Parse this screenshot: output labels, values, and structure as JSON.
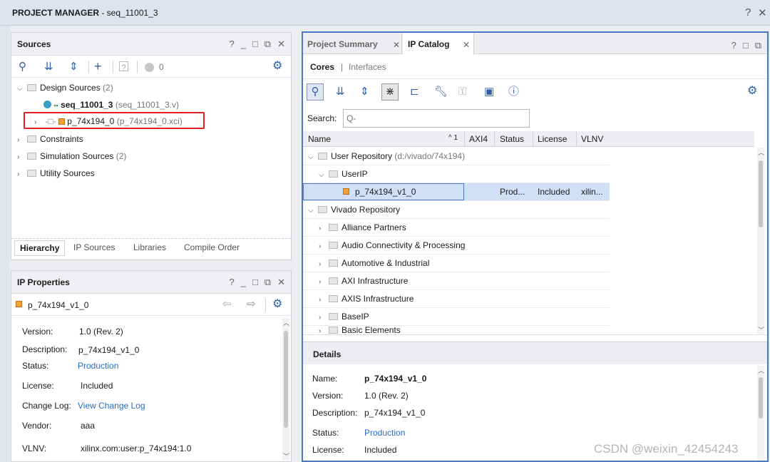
{
  "window": {
    "title": "PROJECT MANAGER",
    "project": " - seq_11001_3",
    "help": "?",
    "close": "✕"
  },
  "sources": {
    "title": "Sources",
    "badge": "0",
    "tree": {
      "design_sources": "Design Sources",
      "design_count": "(2)",
      "top_module": "seq_11001_3",
      "top_file": "(seq_11001_3.v)",
      "ip_module": "p_74x194_0",
      "ip_file": "(p_74x194_0.xci)",
      "constraints": "Constraints",
      "sim_sources": "Simulation Sources",
      "sim_count": "(2)",
      "utility": "Utility Sources"
    },
    "tabs": [
      "Hierarchy",
      "IP Sources",
      "Libraries",
      "Compile Order"
    ]
  },
  "ip_properties": {
    "title": "IP Properties",
    "ip_name": "p_74x194_v1_0",
    "fields": {
      "version_label": "Version:",
      "version": "1.0 (Rev. 2)",
      "description_label": "Description:",
      "description": "p_74x194_v1_0",
      "status_label": "Status:",
      "status": "Production",
      "license_label": "License:",
      "license": "Included",
      "changelog_label": "Change Log:",
      "changelog": "View Change Log",
      "vendor_label": "Vendor:",
      "vendor": "aaa",
      "vlnv_label": "VLNV:",
      "vlnv": "xilinx.com:user:p_74x194:1.0"
    }
  },
  "ipcatalog": {
    "tabs": [
      "Project Summary",
      "IP Catalog"
    ],
    "subtabs": {
      "cores": "Cores",
      "sep": "|",
      "interfaces": "Interfaces"
    },
    "search_label": "Search:",
    "search_placeholder": "Q-",
    "columns": {
      "name": "Name",
      "sort": "^ 1",
      "axi4": "AXI4",
      "status": "Status",
      "license": "License",
      "vlnv": "VLNV"
    },
    "rows": {
      "user_repo": "User Repository",
      "user_repo_path": "(d:/vivado/74x194)",
      "userip": "UserIP",
      "ip": "p_74x194_v1_0",
      "ip_status": "Prod...",
      "ip_license": "Included",
      "ip_vlnv": "xilin...",
      "vivado_repo": "Vivado Repository",
      "cats": [
        "Alliance Partners",
        "Audio Connectivity & Processing",
        "Automotive & Industrial",
        "AXI Infrastructure",
        "AXIS Infrastructure",
        "BaseIP",
        "Basic Elements"
      ]
    },
    "details": {
      "title": "Details",
      "name_label": "Name:",
      "name": "p_74x194_v1_0",
      "version_label": "Version:",
      "version": "1.0 (Rev. 2)",
      "description_label": "Description:",
      "description": "p_74x194_v1_0",
      "status_label": "Status:",
      "status": "Production",
      "license_label": "License:",
      "license": "Included"
    }
  },
  "watermark": "CSDN @weixin_42454243",
  "colors": {
    "accent": "#2f5fa8",
    "highlight_border": "#e02020",
    "selected_row": "#cfe0f7",
    "focus_border": "#4a78c4"
  }
}
